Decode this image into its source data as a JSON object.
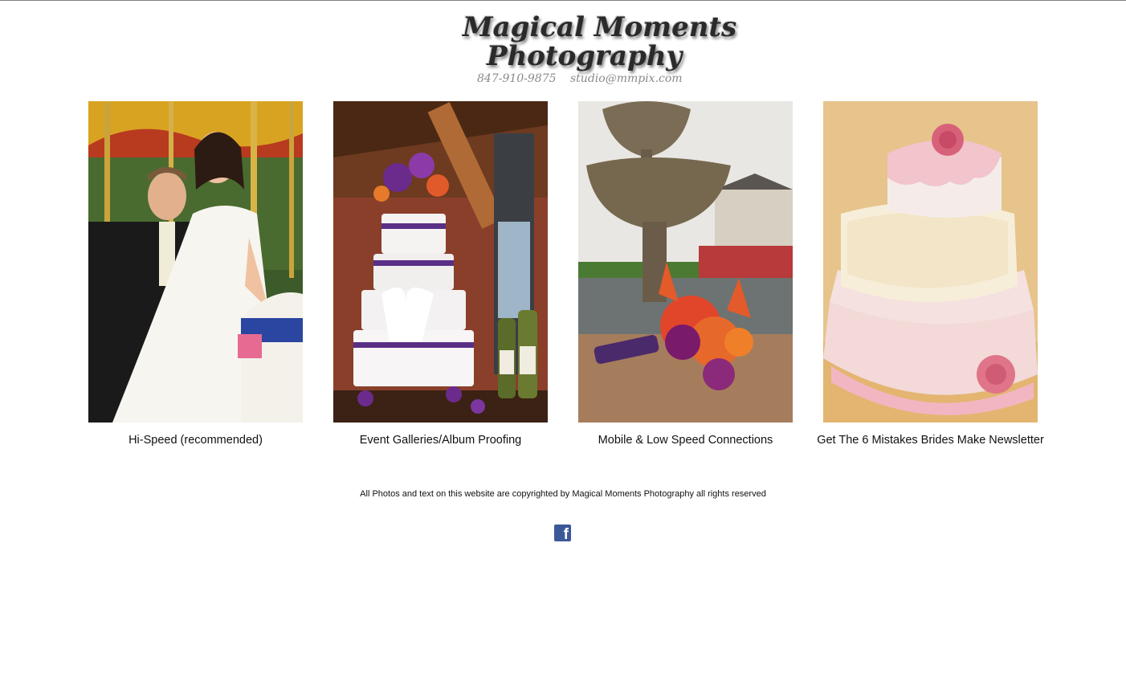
{
  "header": {
    "logo_line1": "Magical Moments",
    "logo_line2": "Photography",
    "phone": "847-910-9875",
    "email": "studio@mmpix.com"
  },
  "galleries": [
    {
      "label": "Hi-Speed (recommended)",
      "image": "bride-groom-carousel"
    },
    {
      "label": "Event Galleries/Album Proofing",
      "image": "purple-wedding-cake-with-wine"
    },
    {
      "label": "Mobile & Low Speed Connections",
      "image": "bouquet-by-fountain"
    },
    {
      "label": "Get The 6 Mistakes Brides Make Newsletter",
      "image": "pink-tiered-cake"
    }
  ],
  "footer": {
    "copyright": "All Photos and text on this website are copyrighted by Magical Moments Photography all rights reserved",
    "facebook_icon": "facebook-icon",
    "facebook_color": "#3b5998"
  }
}
